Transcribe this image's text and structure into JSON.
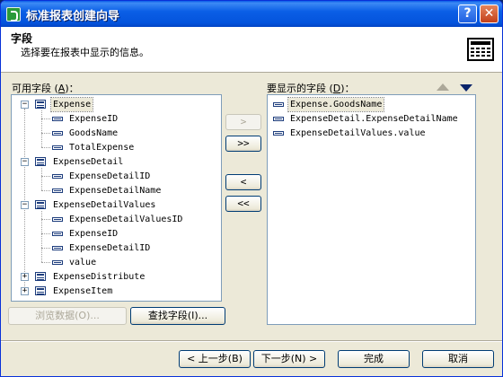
{
  "window": {
    "title": "标准报表创建向导",
    "help_label": "?",
    "close_label": "✕"
  },
  "header": {
    "title": "字段",
    "subtitle": "选择要在报表中显示的信息。",
    "icon": "report-table-icon"
  },
  "available": {
    "label_text": "可用字段 (",
    "label_key": "A",
    "label_end": ")：",
    "tree": [
      {
        "label": "Expense",
        "type": "table",
        "expanded": true,
        "selected": true,
        "children": [
          "ExpenseID",
          "GoodsName",
          "TotalExpense"
        ]
      },
      {
        "label": "ExpenseDetail",
        "type": "table",
        "expanded": true,
        "children": [
          "ExpenseDetailID",
          "ExpenseDetailName"
        ]
      },
      {
        "label": "ExpenseDetailValues",
        "type": "table",
        "expanded": true,
        "children": [
          "ExpenseDetailValuesID",
          "ExpenseID",
          "ExpenseDetailID",
          "value"
        ]
      },
      {
        "label": "ExpenseDistribute",
        "type": "table",
        "expanded": false,
        "children": []
      },
      {
        "label": "ExpenseItem",
        "type": "table",
        "expanded": false,
        "children": []
      }
    ]
  },
  "selected_fields": {
    "label_text": "要显示的字段 (",
    "label_key": "D",
    "label_end": ")：",
    "items": [
      {
        "label": "Expense.GoodsName",
        "selected": true
      },
      {
        "label": "ExpenseDetail.ExpenseDetailName",
        "selected": false
      },
      {
        "label": "ExpenseDetailValues.value",
        "selected": false
      }
    ]
  },
  "move_buttons": {
    "add_one": ">",
    "add_all": ">>",
    "remove_one": "<",
    "remove_all": "<<"
  },
  "order_buttons": {
    "up_icon": "move-up-icon",
    "down_icon": "move-down-icon"
  },
  "browse_button": "浏览数据(O)...",
  "find_button": "查找字段(I)...",
  "footer": {
    "back": "< 上一步(B)",
    "next": "下一步(N) >",
    "finish": "完成",
    "cancel": "取消"
  },
  "colors": {
    "title_bar": "#0b5fe6",
    "dialog_bg": "#ece9d8",
    "panel_border": "#7f9db9",
    "button_border": "#003c74"
  }
}
